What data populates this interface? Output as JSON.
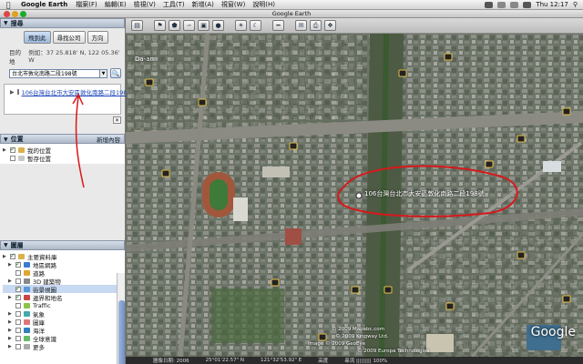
{
  "menubar": {
    "app_name": "Google Earth",
    "items": [
      "檔案(F)",
      "編輯(E)",
      "檢視(V)",
      "工具(T)",
      "新增(A)",
      "視窗(W)",
      "說明(H)"
    ],
    "clock": "Thu 12:17"
  },
  "window": {
    "title": "Google Earth"
  },
  "toolbar": {
    "buttons": [
      "sidebar-icon",
      "placemark-icon",
      "polygon-icon",
      "path-icon",
      "overlay-icon",
      "tour-icon",
      "sun-icon",
      "planets-icon",
      "ruler-icon",
      "email-icon",
      "print-icon",
      "maps-icon"
    ]
  },
  "search": {
    "header": "搜尋",
    "tabs": [
      "飛到此",
      "尋找公司",
      "方向"
    ],
    "active_tab": "飛到此",
    "prompt": "目的地",
    "example": "例如：37 25.818' N, 122 05.36' W",
    "query": "台北市敦化南路二段198號",
    "result": "106台灣台北市大安區敦化南路二段198號"
  },
  "places": {
    "header": "位置",
    "add_label": "新增內容",
    "items": [
      {
        "label": "我的位置",
        "checked": true,
        "expanded": true
      },
      {
        "label": "暫存位置",
        "checked": false,
        "expanded": false
      }
    ]
  },
  "layers": {
    "header": "圖層",
    "items": [
      {
        "label": "主要資料庫",
        "checked": true,
        "expanded": true,
        "indent": 0
      },
      {
        "label": "地區網路",
        "checked": true,
        "expanded": true,
        "indent": 1
      },
      {
        "label": "道路",
        "checked": false,
        "expanded": false,
        "indent": 1
      },
      {
        "label": "3D 建築物",
        "checked": false,
        "expanded": true,
        "indent": 1
      },
      {
        "label": "街景視圖",
        "checked": true,
        "expanded": false,
        "indent": 1,
        "selected": true
      },
      {
        "label": "邊界和地名",
        "checked": true,
        "expanded": true,
        "indent": 1
      },
      {
        "label": "Traffic",
        "checked": false,
        "expanded": false,
        "indent": 1
      },
      {
        "label": "氣象",
        "checked": false,
        "expanded": true,
        "indent": 1
      },
      {
        "label": "圖庫",
        "checked": false,
        "expanded": true,
        "indent": 1
      },
      {
        "label": "海洋",
        "checked": false,
        "expanded": true,
        "indent": 1
      },
      {
        "label": "全球意識",
        "checked": false,
        "expanded": true,
        "indent": 1
      },
      {
        "label": "更多",
        "checked": false,
        "expanded": true,
        "indent": 1
      }
    ]
  },
  "map": {
    "pin_label": "106台灣台北市大安區敦化南路二段198號",
    "corner_label": "Da-an",
    "credits": [
      "© 2009 Mapabc.com",
      "© 2009 Kingway Ltd.",
      "Image © 2009 GeoEye",
      "© 2009 Europa Technologies"
    ],
    "logo": "Google"
  },
  "status": {
    "imagery_date": "圖像日期: 2006",
    "lat": "25°01'22.57\" N",
    "lon": "121°32'53.92\" E",
    "elevation": "高度",
    "streaming": "串流 ||||||||| 100%"
  },
  "annotation_color": "#d8181b"
}
